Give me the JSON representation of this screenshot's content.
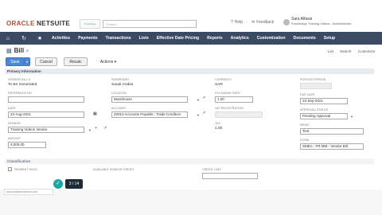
{
  "header": {
    "logo_oracle": "ORACLE",
    "logo_netsuite": "NETSUITE",
    "customer_logo": "Knowledge",
    "search_placeholder": "Search",
    "help": "Help",
    "feedback": "Feedback",
    "user_name": "Sara Alfassi",
    "user_role": "Knowledge Training Videos - Administrator"
  },
  "nav": {
    "items": [
      "Activities",
      "Payments",
      "Transactions",
      "Lists",
      "Effective Date Pricing",
      "Reports",
      "Analytics",
      "Customization",
      "Documents",
      "Setup"
    ]
  },
  "record": {
    "title": "Bill",
    "save": "Save",
    "cancel": "Cancel",
    "recalc": "Recalc",
    "actions": "Actions",
    "links": [
      "List",
      "Search",
      "Customize"
    ]
  },
  "sections": {
    "primary": "Primary Information",
    "classification": "Classification"
  },
  "fields": {
    "vendor_bill_no_label": "VENDOR BILL #",
    "vendor_bill_no_value": "To Be Generated",
    "reference_no_label": "REFERENCE NO.",
    "date_label": "DATE",
    "date_value": "23-Aug-2021",
    "vendor_label": "VENDOR",
    "vendor_value": "Training Videos Vendor",
    "amount_label": "AMOUNT",
    "amount_value": "4,000.00",
    "subsidiary_label": "SUBSIDIARY",
    "subsidiary_value": "Saudi Arabia",
    "location_label": "LOCATION",
    "location_value": "Warehouse",
    "account_label": "ACCOUNT",
    "account_value": "20010 Accounts Payable : Trade Creditors",
    "currency_label": "CURRENCY",
    "currency_value": "SAR",
    "exchange_rate_label": "EXCHANGE RATE",
    "exchange_rate_value": "1.00",
    "vat_registration_label": "VAT REGISTRATION",
    "tax_label": "TAX",
    "tax_value": "1.00",
    "posting_period_label": "POSTING PERIOD",
    "due_date_label": "DUE DATE",
    "due_date_value": "22-Sep-2021",
    "approval_status_label": "APPROVAL STATUS",
    "approval_status_value": "Pending Approval",
    "memo_label": "MEMO",
    "memo_value": "Test",
    "form_label": "FORM",
    "form_value": "SMEA - FR MM - Vendor Bill",
    "payment_hold_label": "PAYMENT HOLD",
    "available_vendor_credit_label": "AVAILABLE VENDOR CREDIT",
    "credit_limit_label": "CREDIT LIMIT"
  },
  "footer": {
    "url": "www.softwareadvice.com",
    "page": "3 / 14"
  },
  "colors": {
    "nav_bg": "#3b4a63",
    "save_blue": "#4d88d6",
    "oracle_red": "#c74634",
    "accent_teal": "#1da6a6"
  }
}
